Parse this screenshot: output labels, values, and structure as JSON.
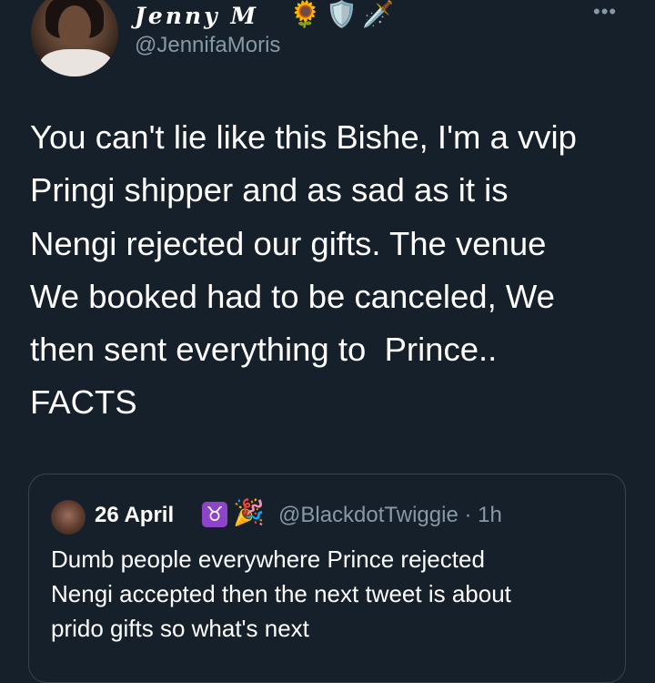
{
  "author": {
    "display_name": "Jenny M",
    "name_emojis": [
      "🌻",
      "🛡️",
      "🗡️"
    ],
    "handle": "@JennifaMoris"
  },
  "more_icon": "•••",
  "tweet": {
    "lines": [
      "You can't lie like this Bishe, I'm a vvip",
      "Pringi shipper and as sad as it is",
      "Nengi rejected our gifts. The venue",
      "We booked had to be canceled, We",
      "then sent everything to  Prince..",
      "FACTS"
    ]
  },
  "quoted": {
    "display_name": "26 April",
    "badge_emojis": [
      "♉",
      "🎉"
    ],
    "handle_time": "@BlackdotTwiggie · 1h",
    "lines": [
      "Dumb people everywhere Prince rejected",
      "Nengi accepted then the next tweet is about",
      "prido gifts so what's next"
    ]
  },
  "colors": {
    "background": "#15202b",
    "secondary_text": "#8899a6",
    "border": "#38444d"
  }
}
